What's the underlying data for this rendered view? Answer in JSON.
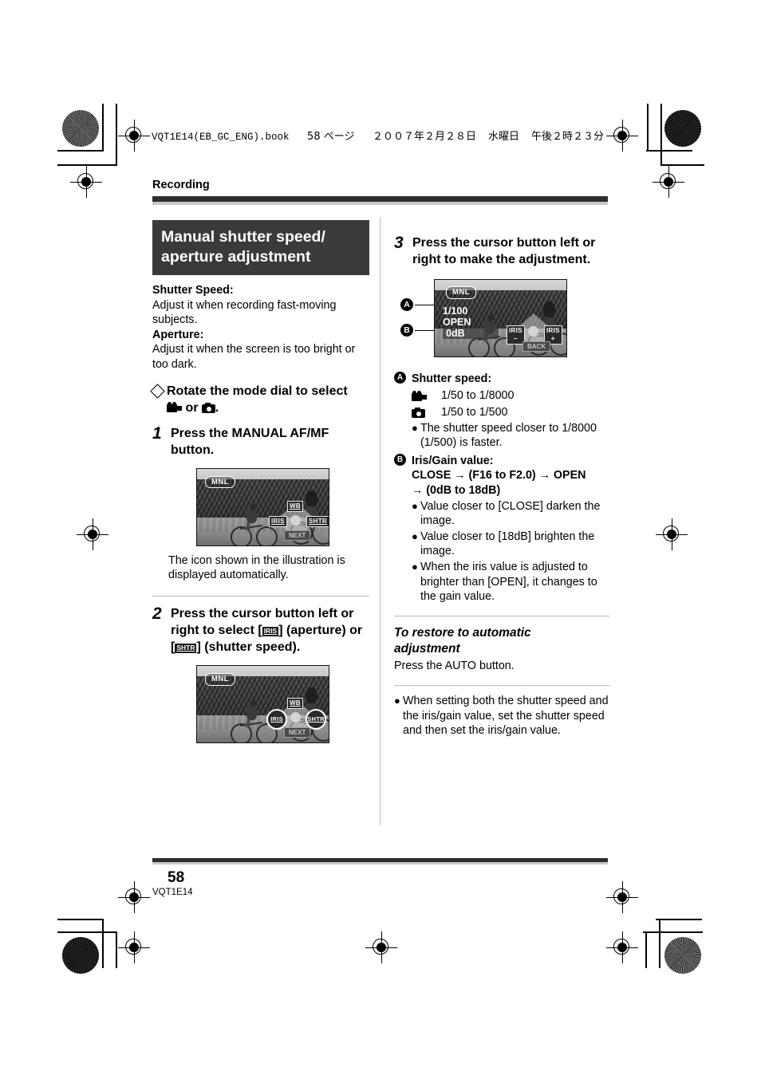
{
  "print_header": {
    "filename": "VQT1E14(EB_GC_ENG).book",
    "page_marker": "58 ページ",
    "date": "２００７年２月２８日",
    "weekday": "水曜日",
    "time": "午後２時２３分"
  },
  "section": {
    "label": "Recording"
  },
  "title": {
    "line1": "Manual shutter speed/",
    "line2": "aperture adjustment"
  },
  "intro": {
    "shutter_heading": "Shutter Speed:",
    "shutter_text": "Adjust it when recording fast-moving subjects.",
    "aperture_heading": "Aperture:",
    "aperture_text": "Adjust it when the screen is too bright or too dark."
  },
  "prereq": {
    "text_before": "Rotate the mode dial to select",
    "icon_a": "camcorder-mode-icon",
    "or_text": "or",
    "icon_b": "still-camera-mode-icon",
    "period": "."
  },
  "steps": [
    {
      "num": "1",
      "text": "Press the MANUAL AF/MF button."
    },
    {
      "num": "2",
      "text_parts": [
        "Press the cursor button left or right to select [",
        "IRIS",
        "] (aperture) or [",
        "SHTR",
        "] (shutter speed)."
      ]
    },
    {
      "num": "3",
      "text": "Press the cursor button left or right to make the adjustment."
    }
  ],
  "step1": {
    "caption": "The icon shown in the illustration is displayed automatically.",
    "screen": {
      "mnl_badge": "MNL",
      "overlay_top": "WB",
      "overlay_left": "IRIS",
      "overlay_right": "SHTR",
      "overlay_bottom": "NEXT"
    }
  },
  "step2": {
    "screen": {
      "mnl_badge": "MNL",
      "overlay_top": "WB",
      "overlay_left": "IRIS",
      "overlay_right": "SHTR",
      "overlay_bottom": "NEXT"
    }
  },
  "step3": {
    "screen": {
      "mnl_badge": "MNL",
      "shutter_value": "1/100",
      "iris_value": "OPEN",
      "gain_value": "0dB",
      "overlay_left": "IRIS",
      "overlay_left_sign": "−",
      "overlay_right": "IRIS",
      "overlay_right_sign": "+",
      "overlay_bottom": "BACK",
      "callout_a": "A",
      "callout_b": "B"
    }
  },
  "legend": {
    "a": {
      "marker": "A",
      "heading": "Shutter speed:",
      "rows": [
        {
          "icon": "camcorder-mode-icon",
          "value": "1/50 to 1/8000"
        },
        {
          "icon": "still-camera-mode-icon",
          "value": "1/50 to 1/500"
        }
      ],
      "notes": [
        "The shutter speed closer to 1/8000 (1/500) is faster."
      ]
    },
    "b": {
      "marker": "B",
      "heading": "Iris/Gain value:",
      "range_line1": "CLOSE → (F16 to F2.0) → OPEN",
      "range_line2": "→ (0dB to 18dB)",
      "notes": [
        "Value closer to [CLOSE] darken the image.",
        "Value closer to [18dB] brighten the image.",
        "When the iris value is adjusted to brighter than [OPEN], it changes to the gain value."
      ]
    }
  },
  "restore": {
    "heading_line1": "To restore to automatic",
    "heading_line2": "adjustment",
    "body": "Press the AUTO button."
  },
  "final_note": "When setting both the shutter speed and the iris/gain value, set the shutter speed and then set the iris/gain value.",
  "footer": {
    "page_number": "58",
    "doc_code": "VQT1E14"
  }
}
